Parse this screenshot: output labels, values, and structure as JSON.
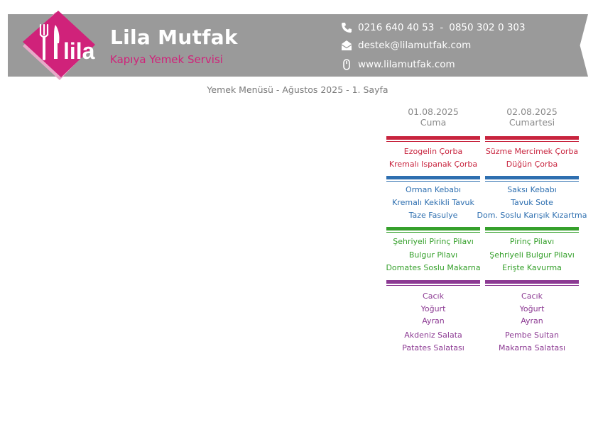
{
  "header": {
    "brand_name": "Lila Mutfak",
    "tagline": "Kapıya Yemek Servisi",
    "logo_text": "lila",
    "phone_1": "0216 640 40 53",
    "phone_separator": "-",
    "phone_2": "0850 302 0 303",
    "email": "destek@lilamutfak.com",
    "website": "www.lilamutfak.com",
    "icons": [
      "phone-icon",
      "envelope-icon",
      "mouse-icon",
      "fork-icon",
      "knife-icon"
    ]
  },
  "subtitle": "Yemek Menüsü - Ağustos 2025 - 1. Sayfa",
  "colors": {
    "header_bg": "#9a9a9a",
    "brand_pink": "#d0227a",
    "soup": "#c8243e",
    "main": "#2e6fb0",
    "side": "#35a02b",
    "extra": "#8c3a93"
  },
  "days": [
    {
      "date": "01.08.2025",
      "weekday": "Cuma",
      "soups": [
        "Ezogelin Çorba",
        "Kremalı Ispanak Çorba"
      ],
      "mains": [
        "Orman Kebabı",
        "Kremalı Kekikli Tavuk",
        "Taze Fasulye"
      ],
      "sides": [
        "Şehriyeli Pirinç Pilavı",
        "Bulgur Pilavı",
        "Domates Soslu Makarna"
      ],
      "extras": [
        "Cacık",
        "Yoğurt",
        "Ayran",
        "Akdeniz Salata",
        "Patates Salatası"
      ]
    },
    {
      "date": "02.08.2025",
      "weekday": "Cumartesi",
      "soups": [
        "Süzme Mercimek Çorba",
        "Düğün Çorba"
      ],
      "mains": [
        "Saksı Kebabı",
        "Tavuk Sote",
        "Dom. Soslu Karışık Kızartma"
      ],
      "sides": [
        "Pirinç Pilavı",
        "Şehriyeli Bulgur Pilavı",
        "Erişte Kavurma"
      ],
      "extras": [
        "Cacık",
        "Yoğurt",
        "Ayran",
        "Pembe Sultan",
        "Makarna Salatası"
      ]
    }
  ]
}
